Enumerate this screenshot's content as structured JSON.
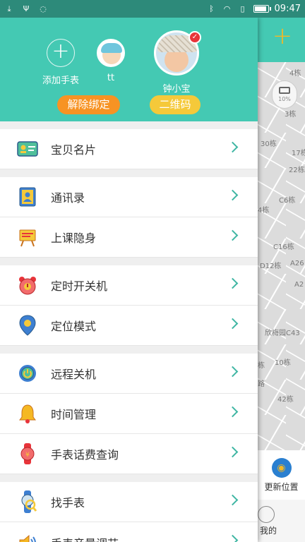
{
  "status_bar": {
    "time": "09:47",
    "battery_level": 0.95
  },
  "map": {
    "labels": [
      "4栋",
      "3栋",
      "30栋",
      "17栋",
      "22栋",
      "C6栋",
      "4栋",
      "C16栋",
      "D12栋",
      "A26",
      "A2",
      "欣梅园C43",
      "栋",
      "10栋",
      "路",
      "42栋"
    ],
    "zoom_value": "10%",
    "update_location_label": "更新位置",
    "mine_label": "我的"
  },
  "header": {
    "add_watch_label": "添加手表",
    "tt_label": "tt",
    "child_name": "钟小宝",
    "unbind_label": "解除绑定",
    "qrcode_label": "二维码"
  },
  "menu": {
    "groups": [
      [
        {
          "label": "宝贝名片",
          "icon": "id-card-icon"
        }
      ],
      [
        {
          "label": "通讯录",
          "icon": "contacts-icon"
        },
        {
          "label": "上课隐身",
          "icon": "class-stealth-icon"
        }
      ],
      [
        {
          "label": "定时开关机",
          "icon": "alarm-clock-icon"
        },
        {
          "label": "定位模式",
          "icon": "location-pin-icon"
        }
      ],
      [
        {
          "label": "远程关机",
          "icon": "power-icon"
        },
        {
          "label": "时间管理",
          "icon": "bell-icon"
        },
        {
          "label": "手表话费查询",
          "icon": "watch-balance-icon"
        }
      ],
      [
        {
          "label": "找手表",
          "icon": "find-watch-icon"
        },
        {
          "label": "手表音量调节",
          "icon": "volume-icon"
        }
      ]
    ]
  },
  "colors": {
    "accent": "#44c9b3",
    "status_bar": "#2d8a7a",
    "orange": "#f79323",
    "yellow": "#f5c93a"
  }
}
